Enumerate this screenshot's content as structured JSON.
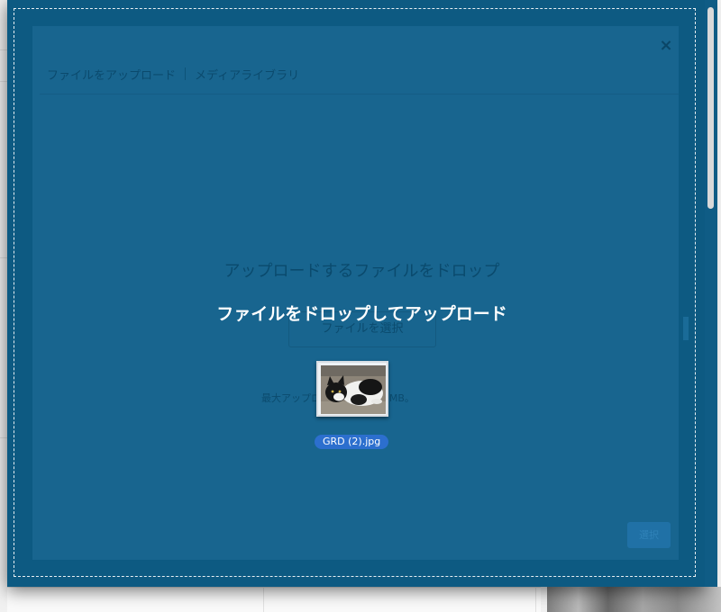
{
  "modal": {
    "close_glyph": "×",
    "tabs": [
      {
        "label": "ファイルをアップロード"
      },
      {
        "label": "メディアライブラリ"
      }
    ]
  },
  "uploader": {
    "drop_instructions": "アップロードするファイルをドロップ",
    "select_files_label": "ファイルを選択",
    "max_size_text": "最大アップロードサイズ: 32MB。",
    "insert_button_label": "選択"
  },
  "drop_overlay": {
    "message": "ファイルをドロップしてアップロード"
  },
  "dragged_file": {
    "name": "GRD (2).jpg",
    "thumbnail_subject": "black-and-white-cat"
  },
  "colors": {
    "overlay": "#0d5a82",
    "file_label": "#2c6fce"
  }
}
